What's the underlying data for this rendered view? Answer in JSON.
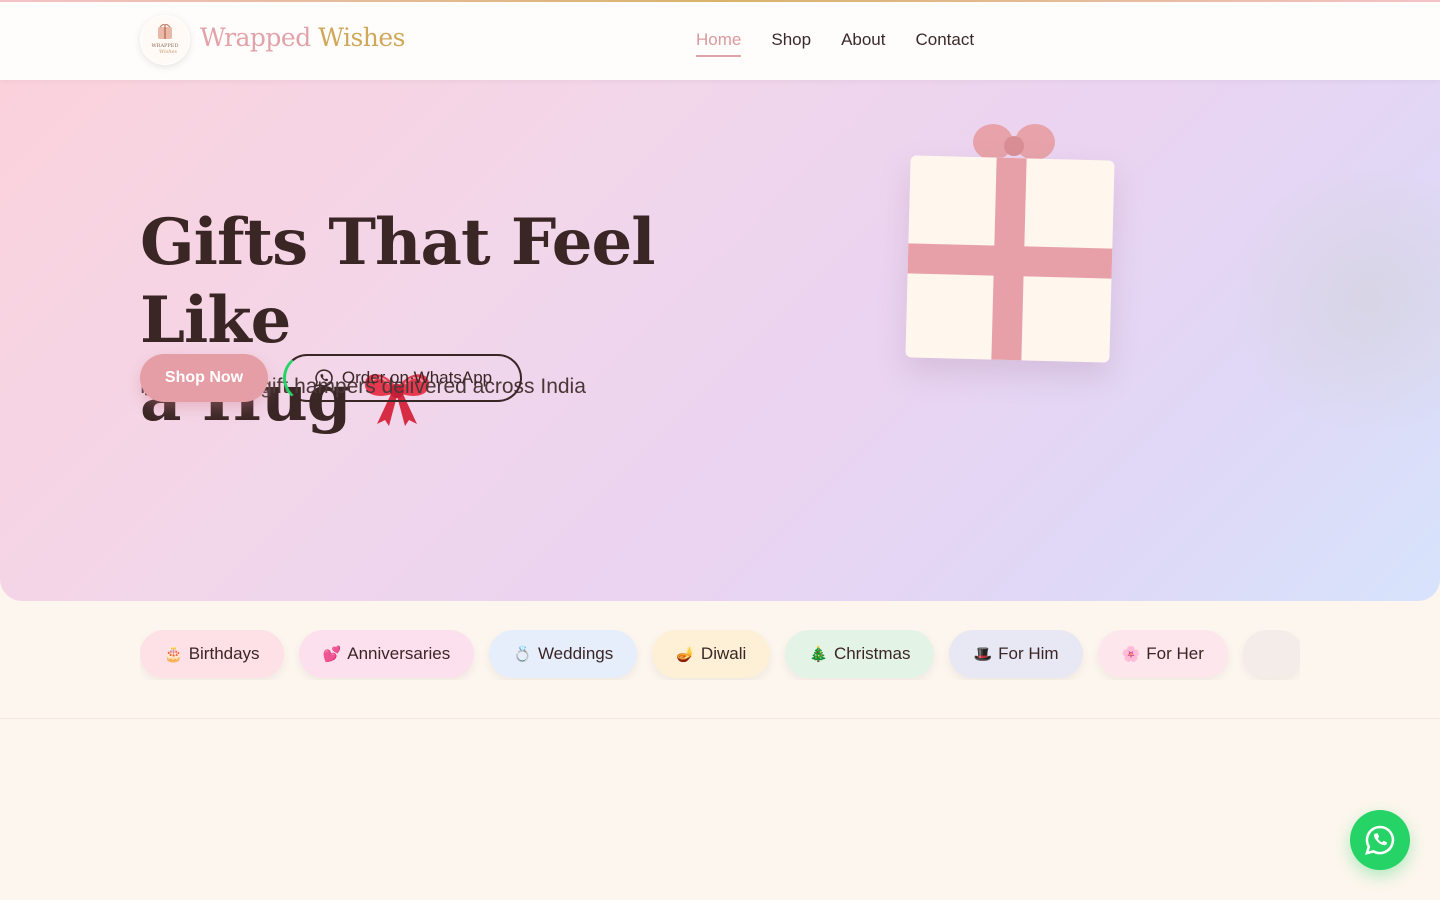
{
  "header": {
    "brand_part1": "Wrapped",
    "brand_part2": "Wishes",
    "logo_text": "Wrapped Wishes",
    "nav": [
      {
        "label": "Home",
        "active": true
      },
      {
        "label": "Shop",
        "active": false
      },
      {
        "label": "About",
        "active": false
      },
      {
        "label": "Contact",
        "active": false
      }
    ]
  },
  "hero": {
    "title_line1": "Gifts That Feel Like",
    "title_line2": "a Hug",
    "title_emoji": "bow-icon",
    "subtitle": "Handcrafted gift hampers delivered across India",
    "shop_button": "Shop Now",
    "whatsapp_button": "Order on WhatsApp"
  },
  "categories": [
    {
      "icon": "🎂",
      "label": "Birthdays",
      "bg": "#fde1e6"
    },
    {
      "icon": "💕",
      "label": "Anniversaries",
      "bg": "#fde0ee"
    },
    {
      "icon": "💍",
      "label": "Weddings",
      "bg": "#e6eefc"
    },
    {
      "icon": "🪔",
      "label": "Diwali",
      "bg": "#fdf0d6"
    },
    {
      "icon": "🎄",
      "label": "Christmas",
      "bg": "#e3f4e6"
    },
    {
      "icon": "🎩",
      "label": "For Him",
      "bg": "#e8e8f4"
    },
    {
      "icon": "🌸",
      "label": "For Her",
      "bg": "#fde6ec"
    },
    {
      "icon": "",
      "label": "",
      "bg": "#f3ece8"
    }
  ],
  "colors": {
    "accent": "#e59ea5",
    "gold": "#cfa85a",
    "dark_text": "#3b2626",
    "whatsapp": "#25d366"
  }
}
